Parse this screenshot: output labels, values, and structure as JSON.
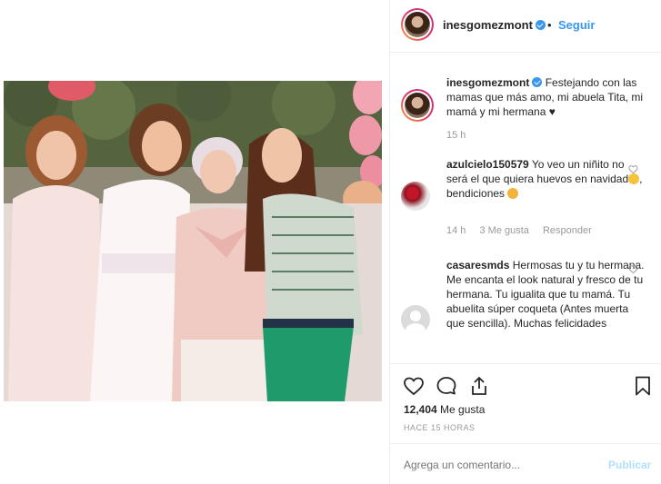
{
  "post": {
    "username": "inesgomezmont",
    "follow_label": "Seguir",
    "dot": "•"
  },
  "caption": {
    "username": "inesgomezmont",
    "text": "Festejando con las mamas que más amo, mi abuela Tita, mi mamá y mi hermana ♥",
    "time": "15 h"
  },
  "comments": [
    {
      "username": "azulcielo150579",
      "text_1": "Yo veo un niñito no será el que quiera huevos en navidad",
      "text_2": ", bendiciones ",
      "time": "14 h",
      "likes": "3 Me gusta",
      "reply": "Responder",
      "avatar": "roses"
    },
    {
      "username": "casaresmds",
      "text": "Hermosas tu y tu hermana. Me encanta el look natural y fresco de tu hermana. Tu igualita que tu mamá. Tu abuelita súper coqueta (Antes muerta que sencilla). Muchas felicidades",
      "avatar": "blank"
    }
  ],
  "actions": {
    "likes_count": "12,404",
    "likes_label": "Me gusta",
    "time_ago": "HACE 15 HORAS"
  },
  "add_comment": {
    "placeholder": "Agrega un comentario...",
    "publish": "Publicar"
  },
  "colors": {
    "link": "#3897f0",
    "muted": "#999999",
    "border": "#efefef"
  }
}
